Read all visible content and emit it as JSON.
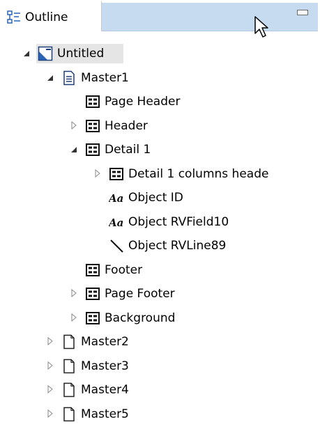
{
  "tab": {
    "label": "Outline",
    "icon": "outline-icon"
  },
  "tree": [
    {
      "id": "untitled",
      "label": "Untitled",
      "level": 0,
      "twisty": "expanded",
      "icon": "report-icon",
      "selected": true
    },
    {
      "id": "master1",
      "label": "Master1",
      "level": 1,
      "twisty": "expanded",
      "icon": "document-lines-icon"
    },
    {
      "id": "page-header",
      "label": "Page Header",
      "level": 2,
      "twisty": "none",
      "icon": "band-icon"
    },
    {
      "id": "header",
      "label": "Header",
      "level": 2,
      "twisty": "collapsed",
      "icon": "band-icon"
    },
    {
      "id": "detail1",
      "label": "Detail 1",
      "level": 2,
      "twisty": "expanded",
      "icon": "band-icon"
    },
    {
      "id": "detail1-columns-header",
      "label": "Detail 1 columns heade",
      "level": 3,
      "twisty": "collapsed",
      "icon": "band-icon"
    },
    {
      "id": "object-id",
      "label": "Object ID",
      "level": 3,
      "twisty": "none",
      "icon": "text-field-icon"
    },
    {
      "id": "object-rvfield10",
      "label": "Object RVField10",
      "level": 3,
      "twisty": "none",
      "icon": "text-field-icon"
    },
    {
      "id": "object-rvline89",
      "label": "Object RVLine89",
      "level": 3,
      "twisty": "none",
      "icon": "line-icon"
    },
    {
      "id": "footer",
      "label": "Footer",
      "level": 2,
      "twisty": "none",
      "icon": "band-icon"
    },
    {
      "id": "page-footer",
      "label": "Page Footer",
      "level": 2,
      "twisty": "collapsed",
      "icon": "band-icon"
    },
    {
      "id": "background",
      "label": "Background",
      "level": 2,
      "twisty": "collapsed",
      "icon": "band-icon"
    },
    {
      "id": "master2",
      "label": "Master2",
      "level": 1,
      "twisty": "collapsed",
      "icon": "document-icon"
    },
    {
      "id": "master3",
      "label": "Master3",
      "level": 1,
      "twisty": "collapsed",
      "icon": "document-icon"
    },
    {
      "id": "master4",
      "label": "Master4",
      "level": 1,
      "twisty": "collapsed",
      "icon": "document-icon"
    },
    {
      "id": "master5",
      "label": "Master5",
      "level": 1,
      "twisty": "collapsed",
      "icon": "document-icon"
    }
  ],
  "colors": {
    "tab_fill": "#c7dbf0",
    "icon_blue": "#2a63b8",
    "selection": "#e5e5e5"
  }
}
